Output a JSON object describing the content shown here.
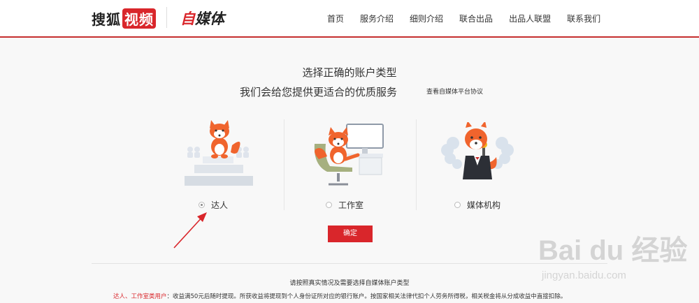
{
  "header": {
    "logo_sohu": "搜狐",
    "logo_video": "视频",
    "logo_media_red": "自",
    "logo_media": "媒体",
    "nav": [
      "首页",
      "服务介绍",
      "细则介绍",
      "联合出品",
      "出品人联盟",
      "联系我们"
    ]
  },
  "main": {
    "title": "选择正确的账户类型",
    "subtitle": "我们会给您提供更适合的优质服务",
    "protocol_link": "查看自媒体平台协议",
    "options": [
      {
        "label": "达人",
        "checked": true
      },
      {
        "label": "工作室",
        "checked": false
      },
      {
        "label": "媒体机构",
        "checked": false
      }
    ],
    "confirm_label": "确定",
    "note_heading": "请按照真实情况及需要选择自媒体账户类型",
    "note_highlight": "达人、工作室类用户",
    "note_text": "：收益满50元后随时提现。所获收益将提现到个人身份证所对应的银行账户。按国家相关法律代扣个人劳务所得税，相关税金将从分成收益中直接扣除。"
  },
  "watermark": {
    "brand": "Bai du 经验",
    "url": "jingyan.baidu.com"
  },
  "colors": {
    "accent": "#d9262b",
    "fox": "#f0642d"
  }
}
